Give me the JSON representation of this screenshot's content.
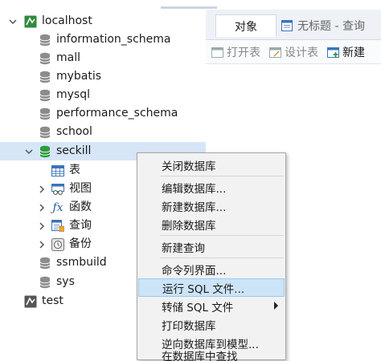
{
  "tree": {
    "connection": "localhost",
    "databases": [
      "information_schema",
      "mall",
      "mybatis",
      "mysql",
      "performance_schema",
      "school"
    ],
    "selected_db": "seckill",
    "children": [
      "表",
      "视图",
      "函数",
      "查询",
      "备份"
    ],
    "databases_after": [
      "ssmbuild",
      "sys"
    ],
    "connection2": "test"
  },
  "right": {
    "tab_objects": "对象",
    "tab_query": "无标题 - 查询",
    "toolbar": {
      "open": "打开表",
      "design": "设计表",
      "new": "新建"
    }
  },
  "menu": {
    "items": [
      "关闭数据库",
      "编辑数据库...",
      "新建数据库...",
      "删除数据库",
      "新建查询",
      "命令列界面...",
      "运行 SQL 文件...",
      "转储 SQL 文件",
      "打印数据库",
      "逆向数据库到模型...",
      "在数据库中查找"
    ],
    "highlighted_index": 6
  },
  "colors": {
    "connection_green": "#2e8b3e",
    "selection_bg": "#d6e6f7",
    "menu_highlight": "#cce4f7"
  }
}
